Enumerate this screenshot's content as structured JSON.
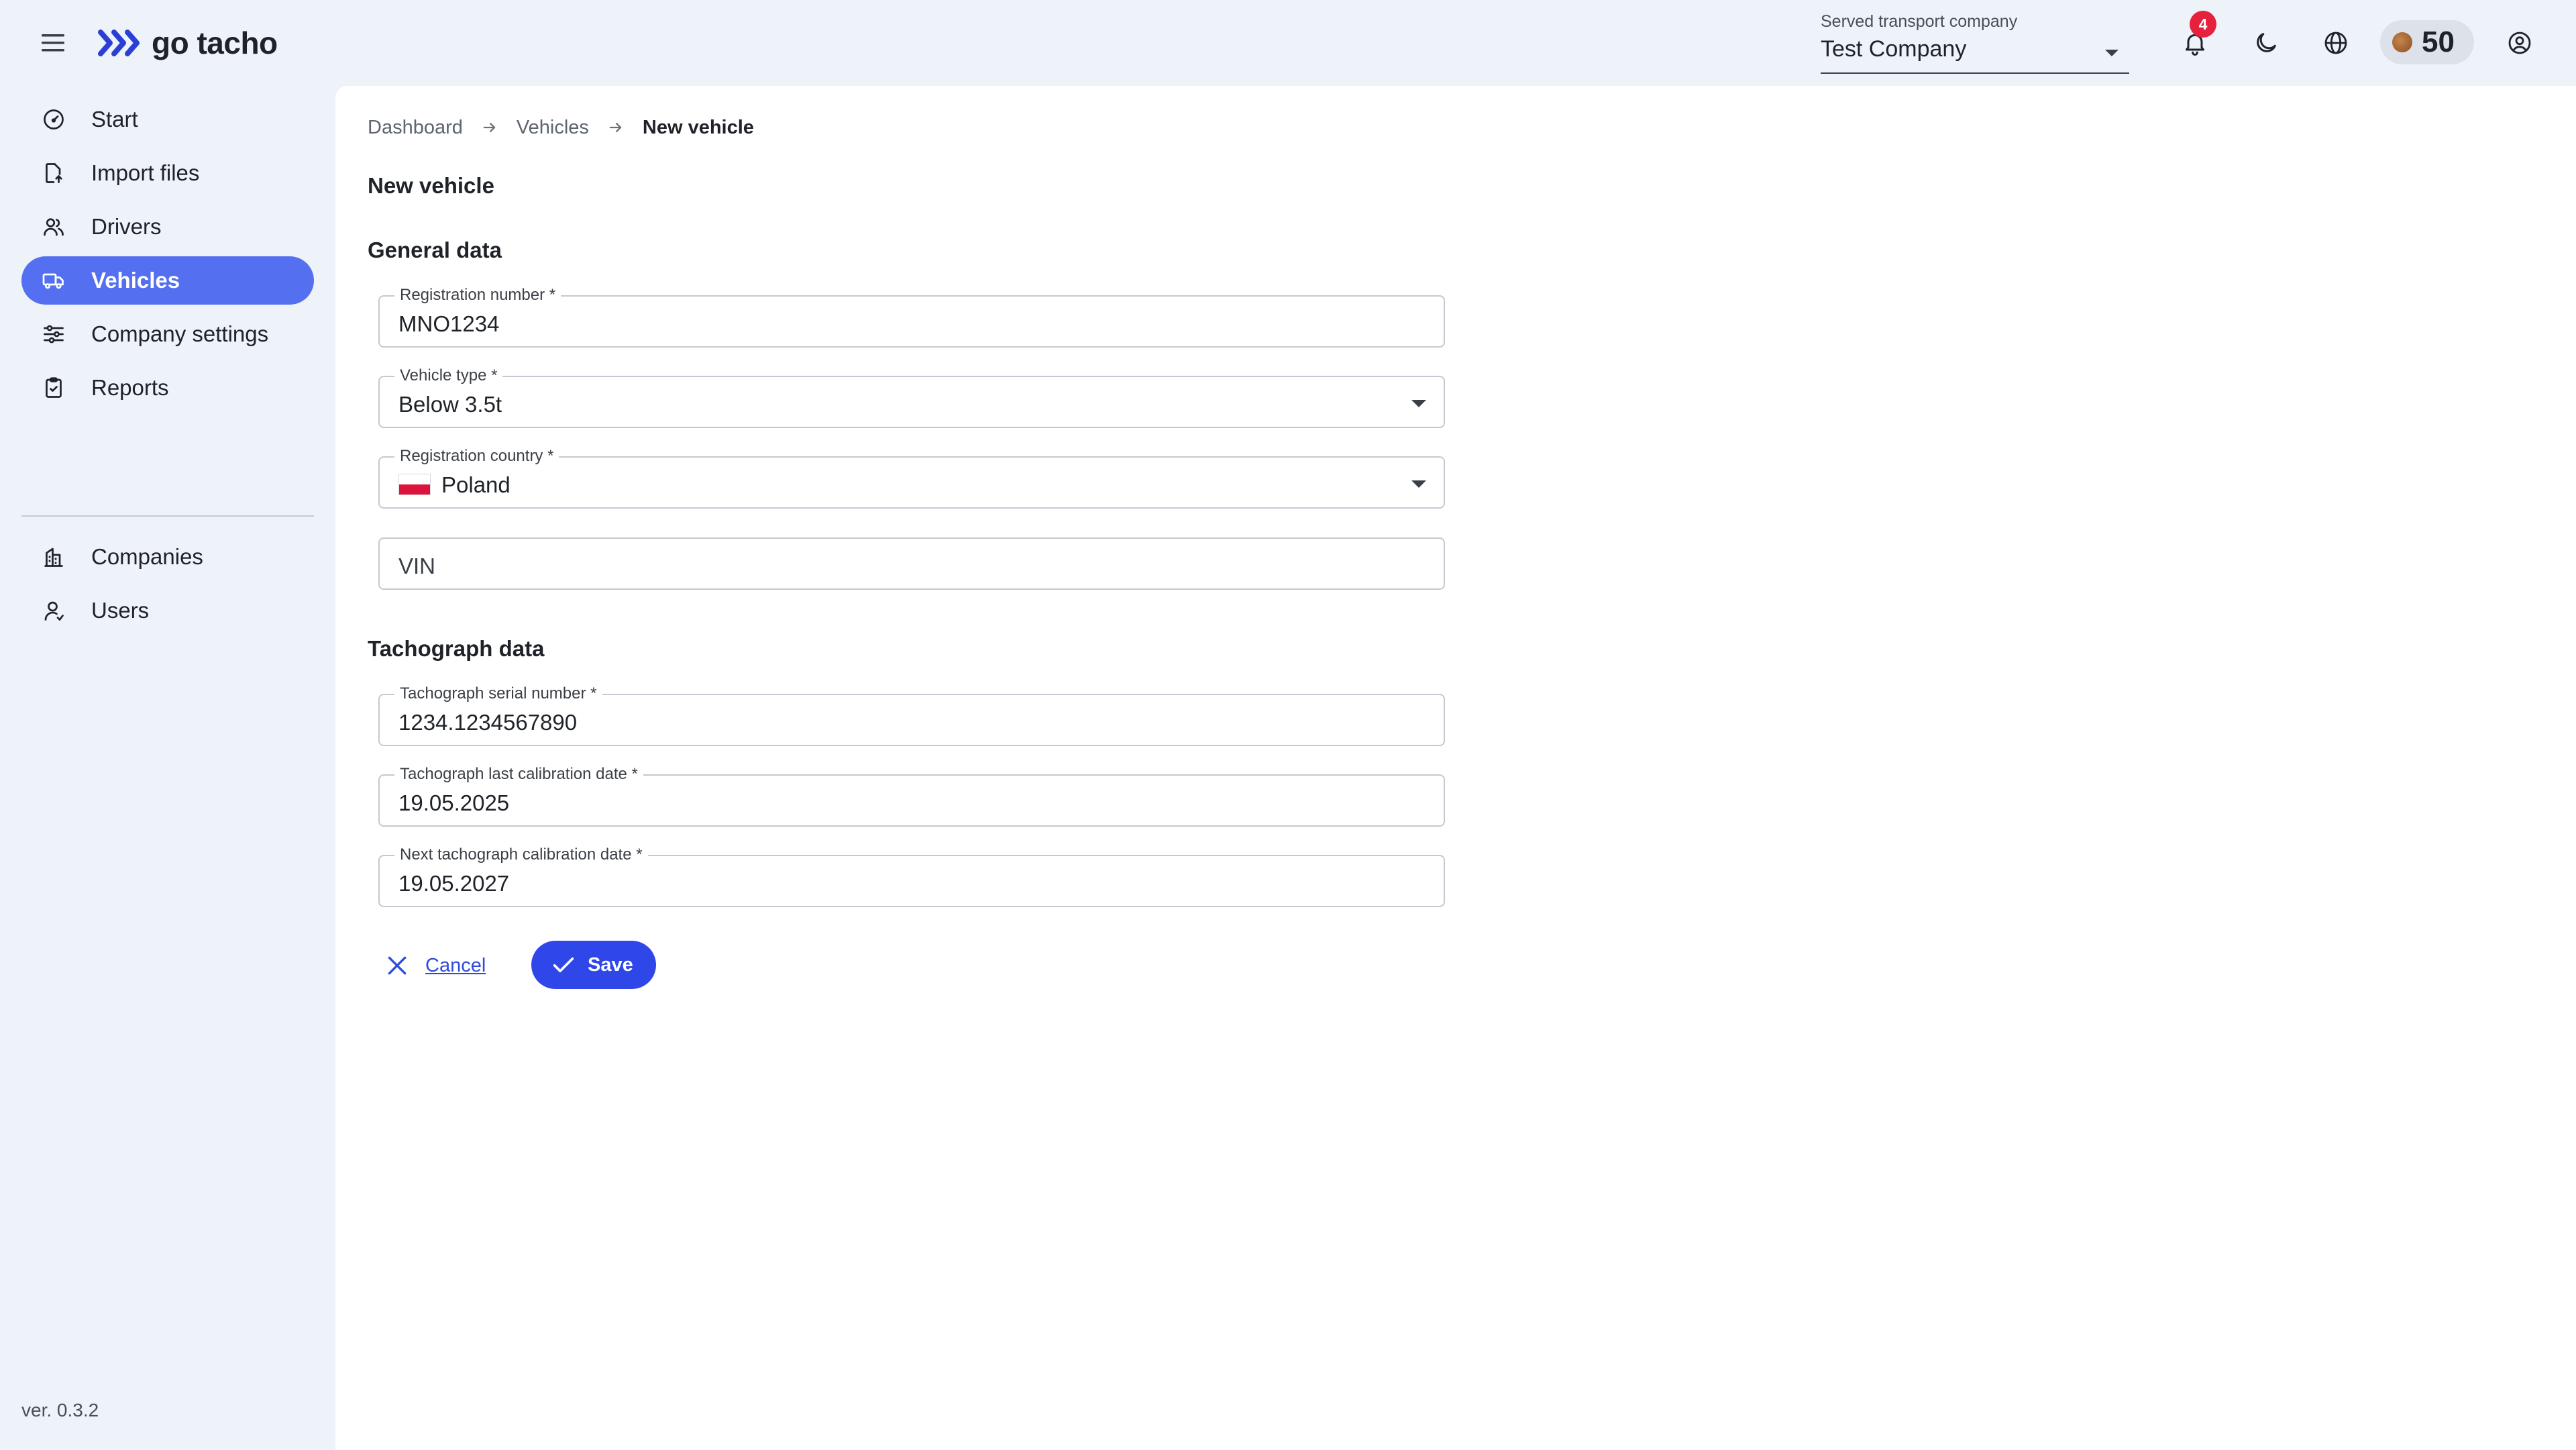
{
  "app": {
    "brand": "go tacho"
  },
  "header": {
    "company_select": {
      "label": "Served transport company",
      "value": "Test Company"
    },
    "notifications_count": "4",
    "credits": "50",
    "icons": [
      "menu-icon",
      "bell-icon",
      "moon-icon",
      "globe-icon",
      "coin-icon",
      "account-icon"
    ]
  },
  "sidebar": {
    "items": [
      {
        "label": "Start",
        "icon": "gauge-icon"
      },
      {
        "label": "Import files",
        "icon": "file-import-icon"
      },
      {
        "label": "Drivers",
        "icon": "users-icon"
      },
      {
        "label": "Vehicles",
        "icon": "truck-icon",
        "active": true
      },
      {
        "label": "Company settings",
        "icon": "sliders-icon"
      },
      {
        "label": "Reports",
        "icon": "clipboard-icon"
      }
    ],
    "admin_items": [
      {
        "label": "Companies",
        "icon": "building-icon"
      },
      {
        "label": "Users",
        "icon": "user-icon"
      }
    ],
    "version": "ver. 0.3.2"
  },
  "breadcrumb": [
    "Dashboard",
    "Vehicles",
    "New vehicle"
  ],
  "page": {
    "title": "New vehicle",
    "general_section": "General data",
    "tachograph_section": "Tachograph data"
  },
  "form": {
    "registration_number": {
      "label": "Registration number *",
      "value": "MNO1234"
    },
    "vehicle_type": {
      "label": "Vehicle type *",
      "value": "Below 3.5t"
    },
    "registration_country": {
      "label": "Registration country *",
      "value": "Poland"
    },
    "vin": {
      "placeholder": "VIN"
    },
    "tachograph_serial": {
      "label": "Tachograph serial number *",
      "value": "1234.1234567890"
    },
    "last_calibration": {
      "label": "Tachograph last calibration date *",
      "value": "19.05.2025"
    },
    "next_calibration": {
      "label": "Next tachograph calibration date *",
      "value": "19.05.2027"
    }
  },
  "actions": {
    "cancel": "Cancel",
    "save": "Save"
  },
  "colors": {
    "accent": "#2f47e8",
    "nav_active": "#5470f0",
    "badge": "#e5213d",
    "background": "#eef2f9"
  }
}
